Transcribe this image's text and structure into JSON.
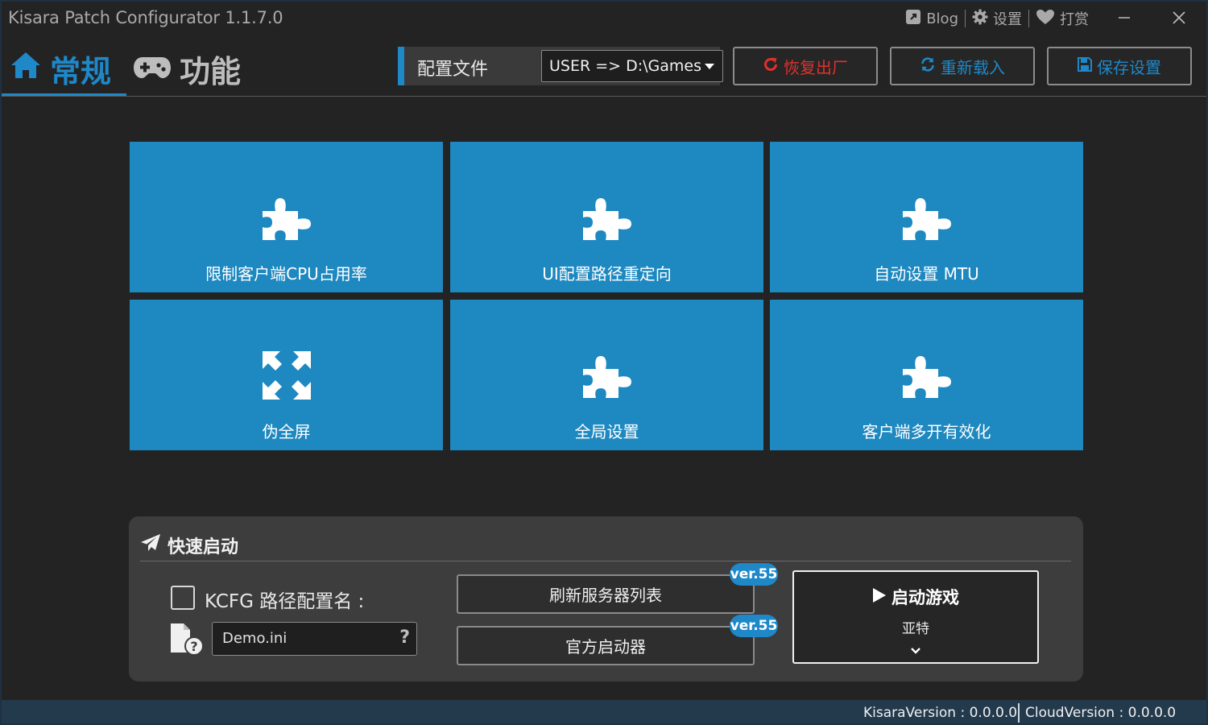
{
  "window": {
    "app_title": "Kisara Patch Configurator",
    "version": "1.1.7.0",
    "links": [
      {
        "label": "Blog",
        "icon": "external-link-icon"
      },
      {
        "label": "设置",
        "icon": "gear-icon"
      },
      {
        "label": "打赏",
        "icon": "heart-icon"
      }
    ],
    "controls": [
      "minimize-icon",
      "close-icon"
    ]
  },
  "nav": {
    "tabs": [
      {
        "label": "常规",
        "icon": "home-icon",
        "active": true
      },
      {
        "label": "功能",
        "icon": "gamepad-icon",
        "active": false
      }
    ]
  },
  "profile": {
    "label": "配置文件",
    "selected": "USER => D:\\Games"
  },
  "toolbar": {
    "reset_label": "恢复出厂",
    "reload_label": "重新载入",
    "save_label": "保存设置"
  },
  "tiles": [
    {
      "label": "限制客户端CPU占用率",
      "icon": "puzzle-icon"
    },
    {
      "label": "UI配置路径重定向",
      "icon": "puzzle-icon"
    },
    {
      "label": "自动设置 MTU",
      "icon": "puzzle-icon"
    },
    {
      "label": "伪全屏",
      "icon": "expand-arrows-icon"
    },
    {
      "label": "全局设置",
      "icon": "puzzle-icon"
    },
    {
      "label": "客户端多开有效化",
      "icon": "puzzle-icon"
    }
  ],
  "quick_launch": {
    "title": "快速启动",
    "kcfg_label": "KCFG 路径配置名 :",
    "kcfg_checked": false,
    "config_file_value": "Demo.ini",
    "help_label": "?",
    "refresh_servers_label": "刷新服务器列表",
    "official_launcher_label": "官方启动器",
    "refresh_version": "ver.55",
    "launcher_version": "ver.55",
    "launch_label": "启动游戏",
    "server_name": "亚特"
  },
  "status": {
    "kisara_label": "KisaraVersion :",
    "kisara_version": "0.0.0.0",
    "cloud_label": "CloudVersion :",
    "cloud_version": "0.0.0.0"
  },
  "colors": {
    "accent": "#1e88c8",
    "tile": "#1e88c0",
    "reset": "#e0312e",
    "background": "#232323",
    "statusbar": "#233a4d"
  }
}
